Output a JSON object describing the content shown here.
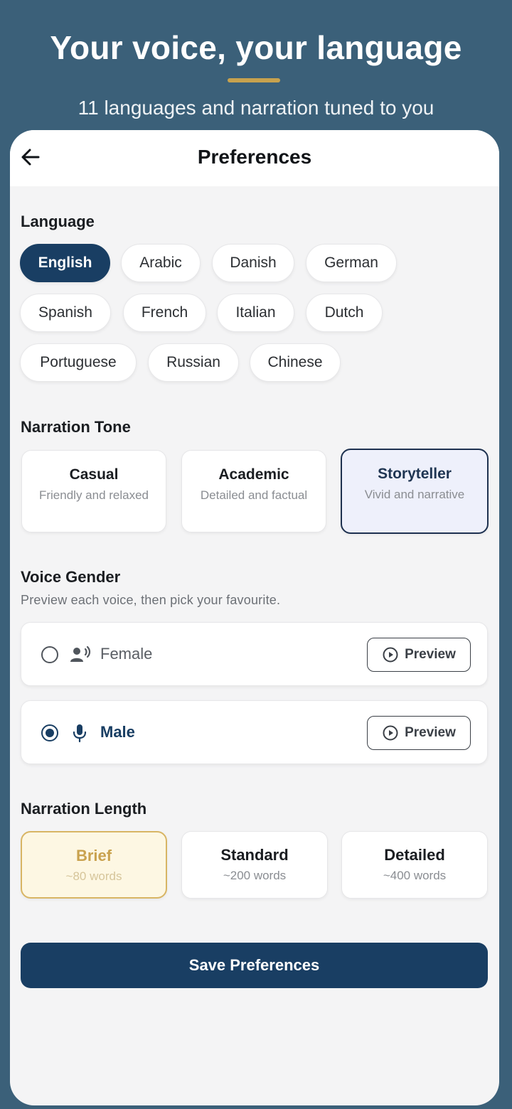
{
  "hero": {
    "title": "Your voice, your language",
    "subtitle": "11 languages and narration tuned to you",
    "accent_color": "#c7a24e"
  },
  "topbar": {
    "title": "Preferences",
    "back_icon": "arrow-left-icon"
  },
  "language": {
    "label": "Language",
    "selected": "English",
    "options": [
      "English",
      "Arabic",
      "Danish",
      "German",
      "Spanish",
      "French",
      "Italian",
      "Dutch",
      "Portuguese",
      "Russian",
      "Chinese"
    ]
  },
  "tone": {
    "label": "Narration Tone",
    "selected": "Storyteller",
    "options": [
      {
        "name": "Casual",
        "desc": "Friendly and relaxed"
      },
      {
        "name": "Academic",
        "desc": "Detailed and factual"
      },
      {
        "name": "Storyteller",
        "desc": "Vivid and narrative"
      }
    ]
  },
  "voice": {
    "label": "Voice Gender",
    "sub": "Preview each voice, then pick your favourite.",
    "selected": "Male",
    "options": [
      {
        "name": "Female",
        "icon": "speaking-person-icon",
        "preview_label": "Preview"
      },
      {
        "name": "Male",
        "icon": "microphone-icon",
        "preview_label": "Preview"
      }
    ]
  },
  "length": {
    "label": "Narration Length",
    "selected": "Brief",
    "options": [
      {
        "name": "Brief",
        "desc": "~80 words"
      },
      {
        "name": "Standard",
        "desc": "~200 words"
      },
      {
        "name": "Detailed",
        "desc": "~400 words"
      }
    ]
  },
  "save_label": "Save Preferences",
  "colors": {
    "primary": "#193e63",
    "background": "#3b6079",
    "gold": "#c7a24e"
  }
}
